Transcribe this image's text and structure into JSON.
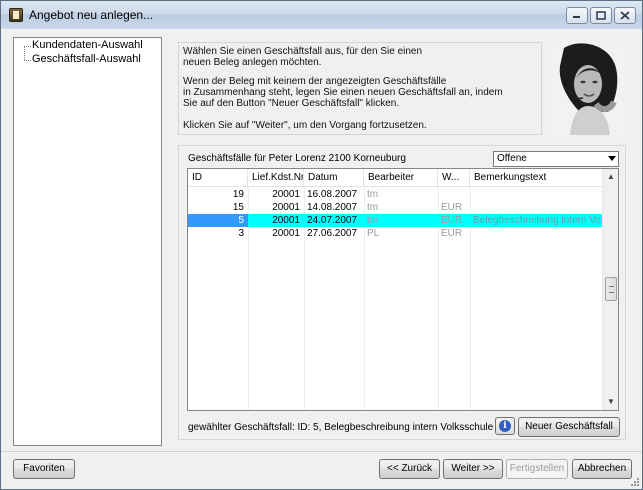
{
  "window": {
    "title": "Angebot neu anlegen..."
  },
  "tree": {
    "items": [
      {
        "label": "Kundendaten-Auswahl"
      },
      {
        "label": "Geschäftsfall-Auswahl"
      }
    ]
  },
  "info": {
    "lines": [
      "Wählen Sie einen Geschäftsfall aus, für den Sie einen",
      "neuen Beleg anlegen möchten.",
      "Wenn der Beleg mit keinem der angezeigten Geschäftsfälle",
      "in Zusammenhang steht, legen Sie einen neuen Geschäftsfall an, indem",
      "Sie auf den Button \"Neuer Geschäftsfall\" klicken.",
      "Klicken Sie auf \"Weiter\", um den Vorgang fortzusetzen."
    ]
  },
  "cases": {
    "caption": "Geschäftsfälle für Peter Lorenz 2100  Korneuburg",
    "filter": {
      "selected": "Offene"
    },
    "columns": [
      "ID",
      "Lief.Kdst.Nr",
      "Datum",
      "Bearbeiter",
      "W...",
      "Bemerkungstext"
    ],
    "rows": [
      {
        "id": "19",
        "kdst": "20001",
        "datum": "16.08.2007",
        "bearbeiter": "tm",
        "waehrung": "",
        "bemerkung": "",
        "selected": false
      },
      {
        "id": "15",
        "kdst": "20001",
        "datum": "14.08.2007",
        "bearbeiter": "tm",
        "waehrung": "EUR",
        "bemerkung": "",
        "selected": false
      },
      {
        "id": "5",
        "kdst": "20001",
        "datum": "24.07.2007",
        "bearbeiter": "tm",
        "waehrung": "EUR",
        "bemerkung": "Belegbeschreibung intern Volks",
        "selected": true
      },
      {
        "id": "3",
        "kdst": "20001",
        "datum": "27.06.2007",
        "bearbeiter": "PL",
        "waehrung": "EUR",
        "bemerkung": "",
        "selected": false
      }
    ]
  },
  "status": {
    "text": "gewählter Geschäftsfall: ID: 5, Belegbeschreibung intern Volksschule"
  },
  "buttons": {
    "new_case": "Neuer Geschäftsfall",
    "favorites": "Favoriten",
    "back": "<< Zurück",
    "next": "Weiter >>",
    "finish": "Fertigstellen",
    "cancel": "Abbrechen"
  },
  "colors": {
    "selection_row": "#00ffff",
    "selection_cell": "#3399ff"
  }
}
